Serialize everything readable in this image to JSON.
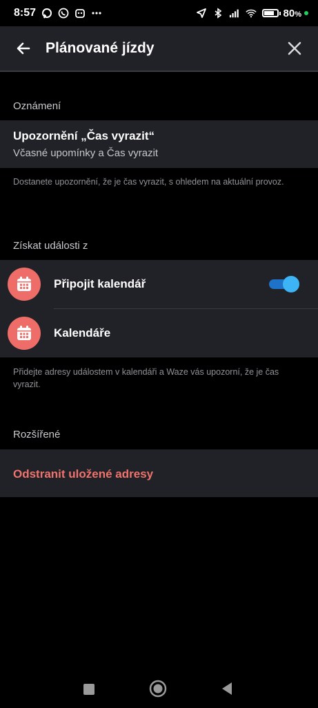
{
  "status_bar": {
    "time": "8:57",
    "battery": "80",
    "battery_unit": "%",
    "battery_level": 0.8
  },
  "app_bar": {
    "title": "Plánované jízdy"
  },
  "notifications": {
    "header": "Oznámení",
    "title": "Upozornění „Čas vyrazit“",
    "subtitle": "Včasné upomínky a Čas vyrazit",
    "hint": "Dostanete upozornění, že je čas vyrazit, s ohledem na aktuální provoz."
  },
  "events": {
    "header": "Získat události z",
    "connect_calendar_label": "Připojit kalendář",
    "connect_calendar_on": true,
    "calendars_label": "Kalendáře",
    "hint": "Přidejte adresy událostem v kalendáři a Waze vás upozorní, že je čas vyrazit."
  },
  "advanced": {
    "header": "Rozšířené",
    "remove_label": "Odstranit uložené adresy"
  },
  "colors": {
    "accent_danger": "#f0736d",
    "calendar_icon_bg": "#ee6d68",
    "toggle_on": "#3cb4f5",
    "card_bg": "#202227"
  },
  "icons": [
    "back-arrow-icon",
    "close-icon",
    "calendar-icon",
    "nav-recents-icon",
    "nav-home-icon",
    "nav-back-icon"
  ]
}
